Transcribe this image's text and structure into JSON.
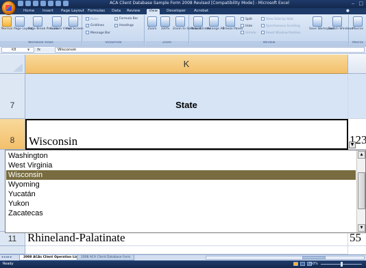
{
  "window": {
    "title": "ACA Client Database Sample Form 2008 Revised [Compatibility Mode] - Microsoft Excel"
  },
  "ribbon_tabs": [
    "Home",
    "Insert",
    "Page Layout",
    "Formulas",
    "Data",
    "Review",
    "View",
    "Developer",
    "Acrobat"
  ],
  "active_tab": "View",
  "ribbon": {
    "workbook_views": {
      "label": "Workbook Views",
      "buttons": [
        "Normal",
        "Page Layout",
        "Page Break Preview",
        "Custom Views",
        "Full Screen"
      ]
    },
    "show_hide": {
      "label": "Show/Hide",
      "ruler": "Ruler",
      "gridlines": "Gridlines",
      "message_bar": "Message Bar",
      "formula_bar": "Formula Bar",
      "headings": "Headings"
    },
    "zoom": {
      "label": "Zoom",
      "buttons": [
        "Zoom",
        "100%",
        "Zoom to Selection"
      ]
    },
    "window": {
      "label": "Window",
      "buttons": [
        "New Window",
        "Arrange All",
        "Freeze Panes"
      ],
      "split": "Split",
      "hide": "Hide",
      "unhide": "Unhide",
      "view_side": "View Side by Side",
      "sync_scroll": "Synchronous Scrolling",
      "reset_pos": "Reset Window Position",
      "save_workspace": "Save Workspace",
      "switch_windows": "Switch Windows"
    },
    "macros": {
      "label": "Macros",
      "button": "Macros"
    }
  },
  "formula_bar": {
    "name_box": "K8",
    "fx": "fx",
    "content": "Wisconsin"
  },
  "grid": {
    "column_letter": "K",
    "rows": [
      {
        "num": "7",
        "value": "State"
      },
      {
        "num": "8",
        "value": "Wisconsin"
      },
      {
        "num": "11",
        "value": "Rhineland-Palatinate"
      }
    ],
    "next_col_row8": "123",
    "next_col_row11": "55"
  },
  "dropdown": {
    "items": [
      "Washington",
      "West Virginia",
      "Wisconsin",
      "Wyoming",
      "Yucatán",
      "Yukon",
      "Zacatecas"
    ],
    "selected_index": 2
  },
  "sheet_tabs": {
    "active": "2008 ACAs Client Operation List",
    "others": [
      "2008 ACA Client Database Form"
    ]
  },
  "status": {
    "ready": "Ready",
    "zoom": "250%"
  }
}
